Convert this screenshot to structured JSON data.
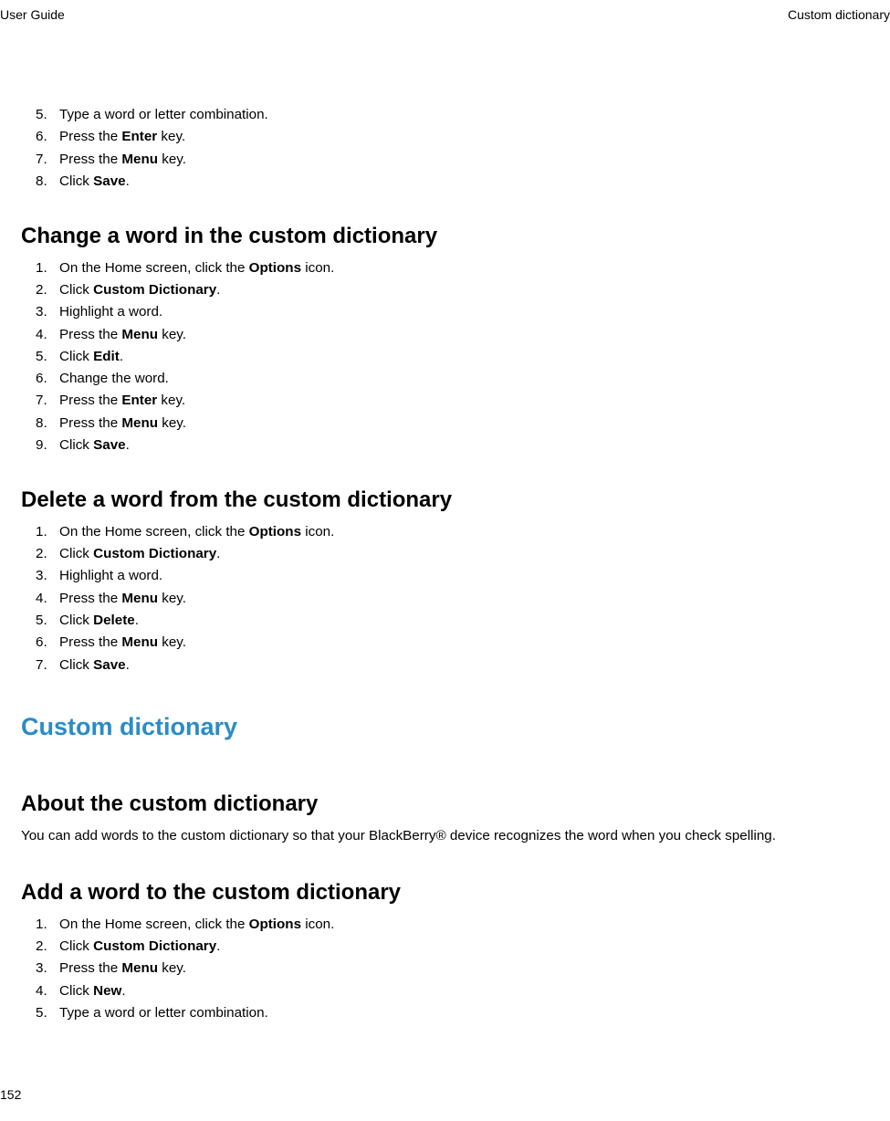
{
  "header": {
    "left": "User Guide",
    "right": "Custom dictionary"
  },
  "page_number": "152",
  "list1": {
    "start_num": 5,
    "items": [
      {
        "parts": [
          {
            "t": "Type a word or letter combination."
          }
        ]
      },
      {
        "parts": [
          {
            "t": "Press the "
          },
          {
            "t": "Enter",
            "b": true
          },
          {
            "t": " key."
          }
        ]
      },
      {
        "parts": [
          {
            "t": "Press the "
          },
          {
            "t": "Menu",
            "b": true
          },
          {
            "t": " key."
          }
        ]
      },
      {
        "parts": [
          {
            "t": "Click "
          },
          {
            "t": "Save",
            "b": true
          },
          {
            "t": "."
          }
        ]
      }
    ]
  },
  "heading_change": "Change a word in the custom dictionary",
  "list2": {
    "start_num": 1,
    "items": [
      {
        "parts": [
          {
            "t": "On the Home screen, click the "
          },
          {
            "t": "Options",
            "b": true
          },
          {
            "t": " icon."
          }
        ]
      },
      {
        "parts": [
          {
            "t": "Click "
          },
          {
            "t": "Custom Dictionary",
            "b": true
          },
          {
            "t": "."
          }
        ]
      },
      {
        "parts": [
          {
            "t": "Highlight a word."
          }
        ]
      },
      {
        "parts": [
          {
            "t": "Press the "
          },
          {
            "t": "Menu",
            "b": true
          },
          {
            "t": " key."
          }
        ]
      },
      {
        "parts": [
          {
            "t": "Click "
          },
          {
            "t": "Edit",
            "b": true
          },
          {
            "t": "."
          }
        ]
      },
      {
        "parts": [
          {
            "t": "Change the word."
          }
        ]
      },
      {
        "parts": [
          {
            "t": "Press the "
          },
          {
            "t": "Enter",
            "b": true
          },
          {
            "t": " key."
          }
        ]
      },
      {
        "parts": [
          {
            "t": "Press the "
          },
          {
            "t": "Menu",
            "b": true
          },
          {
            "t": " key."
          }
        ]
      },
      {
        "parts": [
          {
            "t": "Click "
          },
          {
            "t": "Save",
            "b": true
          },
          {
            "t": "."
          }
        ]
      }
    ]
  },
  "heading_delete": "Delete a word from the custom dictionary",
  "list3": {
    "start_num": 1,
    "items": [
      {
        "parts": [
          {
            "t": "On the Home screen, click the "
          },
          {
            "t": "Options",
            "b": true
          },
          {
            "t": " icon."
          }
        ]
      },
      {
        "parts": [
          {
            "t": "Click "
          },
          {
            "t": "Custom Dictionary",
            "b": true
          },
          {
            "t": "."
          }
        ]
      },
      {
        "parts": [
          {
            "t": "Highlight a word."
          }
        ]
      },
      {
        "parts": [
          {
            "t": "Press the "
          },
          {
            "t": "Menu",
            "b": true
          },
          {
            "t": " key."
          }
        ]
      },
      {
        "parts": [
          {
            "t": "Click "
          },
          {
            "t": "Delete",
            "b": true
          },
          {
            "t": "."
          }
        ]
      },
      {
        "parts": [
          {
            "t": "Press the "
          },
          {
            "t": "Menu",
            "b": true
          },
          {
            "t": " key."
          }
        ]
      },
      {
        "parts": [
          {
            "t": "Click "
          },
          {
            "t": "Save",
            "b": true
          },
          {
            "t": "."
          }
        ]
      }
    ]
  },
  "main_heading": "Custom dictionary",
  "heading_about": "About the custom dictionary",
  "about_para": "You can add words to the custom dictionary so that your BlackBerry® device recognizes the word when you check spelling.",
  "heading_add": "Add a word to the custom dictionary",
  "list4": {
    "start_num": 1,
    "items": [
      {
        "parts": [
          {
            "t": "On the Home screen, click the "
          },
          {
            "t": "Options",
            "b": true
          },
          {
            "t": " icon."
          }
        ]
      },
      {
        "parts": [
          {
            "t": "Click "
          },
          {
            "t": "Custom Dictionary",
            "b": true
          },
          {
            "t": "."
          }
        ]
      },
      {
        "parts": [
          {
            "t": "Press the "
          },
          {
            "t": "Menu",
            "b": true
          },
          {
            "t": " key."
          }
        ]
      },
      {
        "parts": [
          {
            "t": "Click "
          },
          {
            "t": "New",
            "b": true
          },
          {
            "t": "."
          }
        ]
      },
      {
        "parts": [
          {
            "t": "Type a word or letter combination."
          }
        ]
      }
    ]
  }
}
